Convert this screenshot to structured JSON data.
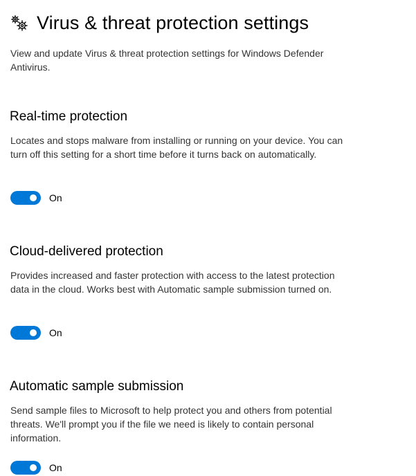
{
  "header": {
    "icon": "gears-icon",
    "title": "Virus & threat protection settings",
    "description": "View and update Virus & threat protection settings for Windows Defender Antivirus."
  },
  "colors": {
    "accent": "#0078d7",
    "text_secondary": "#333333"
  },
  "sections": [
    {
      "title": "Real-time protection",
      "description": "Locates and stops malware from installing or running on your device. You can turn off this setting for a short time before it turns back on automatically.",
      "toggle_state": "On",
      "enabled": true
    },
    {
      "title": "Cloud-delivered protection",
      "description": "Provides increased and faster protection with access to the latest protection data in the cloud. Works best with Automatic sample submission turned on.",
      "toggle_state": "On",
      "enabled": true
    },
    {
      "title": "Automatic sample submission",
      "description": "Send sample files to Microsoft to help protect you and others from potential threats. We'll prompt you if the file we need is likely to contain personal information.",
      "toggle_state": "On",
      "enabled": true
    }
  ]
}
